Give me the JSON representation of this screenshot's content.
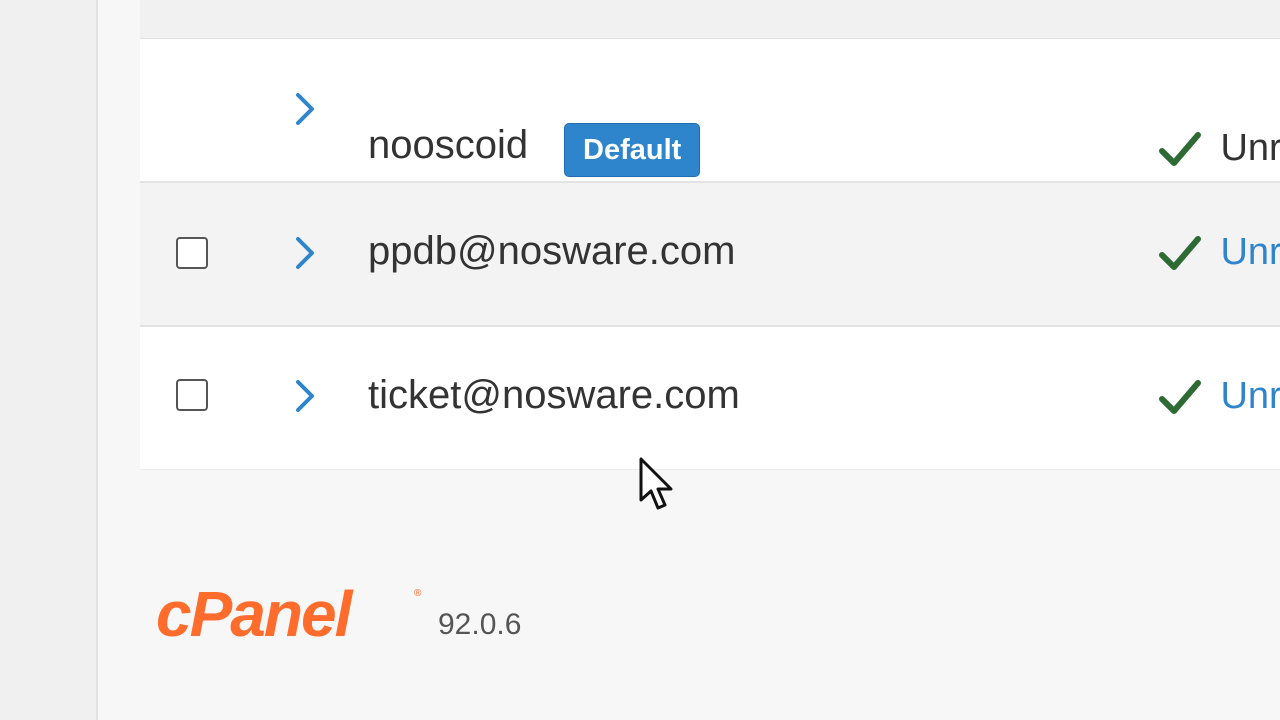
{
  "accounts": [
    {
      "name": "nooscoid",
      "badge": "Default",
      "status": "Unr",
      "has_checkbox": false
    },
    {
      "name": "ppdb@nosware.com",
      "badge": "",
      "status": "Unr",
      "has_checkbox": true
    },
    {
      "name": "ticket@nosware.com",
      "badge": "",
      "status": "Unr",
      "has_checkbox": true
    }
  ],
  "footer": {
    "logo_text": "cPanel",
    "version": "92.0.6"
  },
  "colors": {
    "accent": "#2f85cc",
    "check": "#2e6b34",
    "logo": "#ff6c2c"
  },
  "icons": {
    "expand": "chevron-right-icon",
    "status": "checkmark-icon",
    "pointer": "mouse-cursor-icon"
  }
}
